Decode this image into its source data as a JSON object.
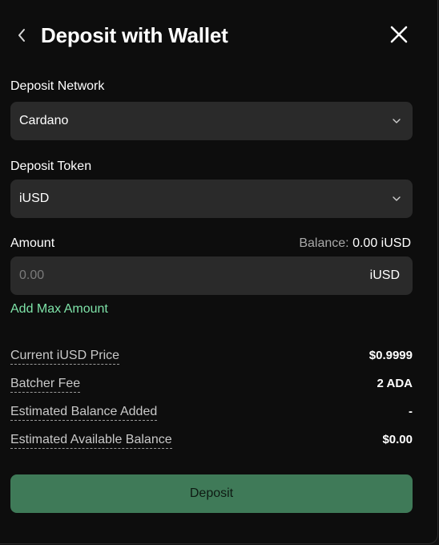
{
  "header": {
    "title": "Deposit with Wallet",
    "back_icon": "chevron-left-icon",
    "close_icon": "close-icon"
  },
  "network": {
    "label": "Deposit Network",
    "selected": "Cardano"
  },
  "token": {
    "label": "Deposit Token",
    "selected": "iUSD"
  },
  "amount": {
    "label": "Amount",
    "balance_label": "Balance:",
    "balance_value": "0.00 iUSD",
    "placeholder": "0.00",
    "unit": "iUSD",
    "max_link": "Add Max Amount"
  },
  "summary": {
    "rows": [
      {
        "label": "Current iUSD Price",
        "value": "$0.9999"
      },
      {
        "label": "Batcher Fee",
        "value": "2 ADA"
      },
      {
        "label": "Estimated Balance Added",
        "value": "-"
      },
      {
        "label": "Estimated Available Balance",
        "value": "$0.00"
      }
    ]
  },
  "actions": {
    "deposit_label": "Deposit"
  },
  "colors": {
    "background": "#0d0d0d",
    "field": "#2a2a2a",
    "accent_green": "#7ee3a8",
    "button_green": "#3f7a58"
  }
}
